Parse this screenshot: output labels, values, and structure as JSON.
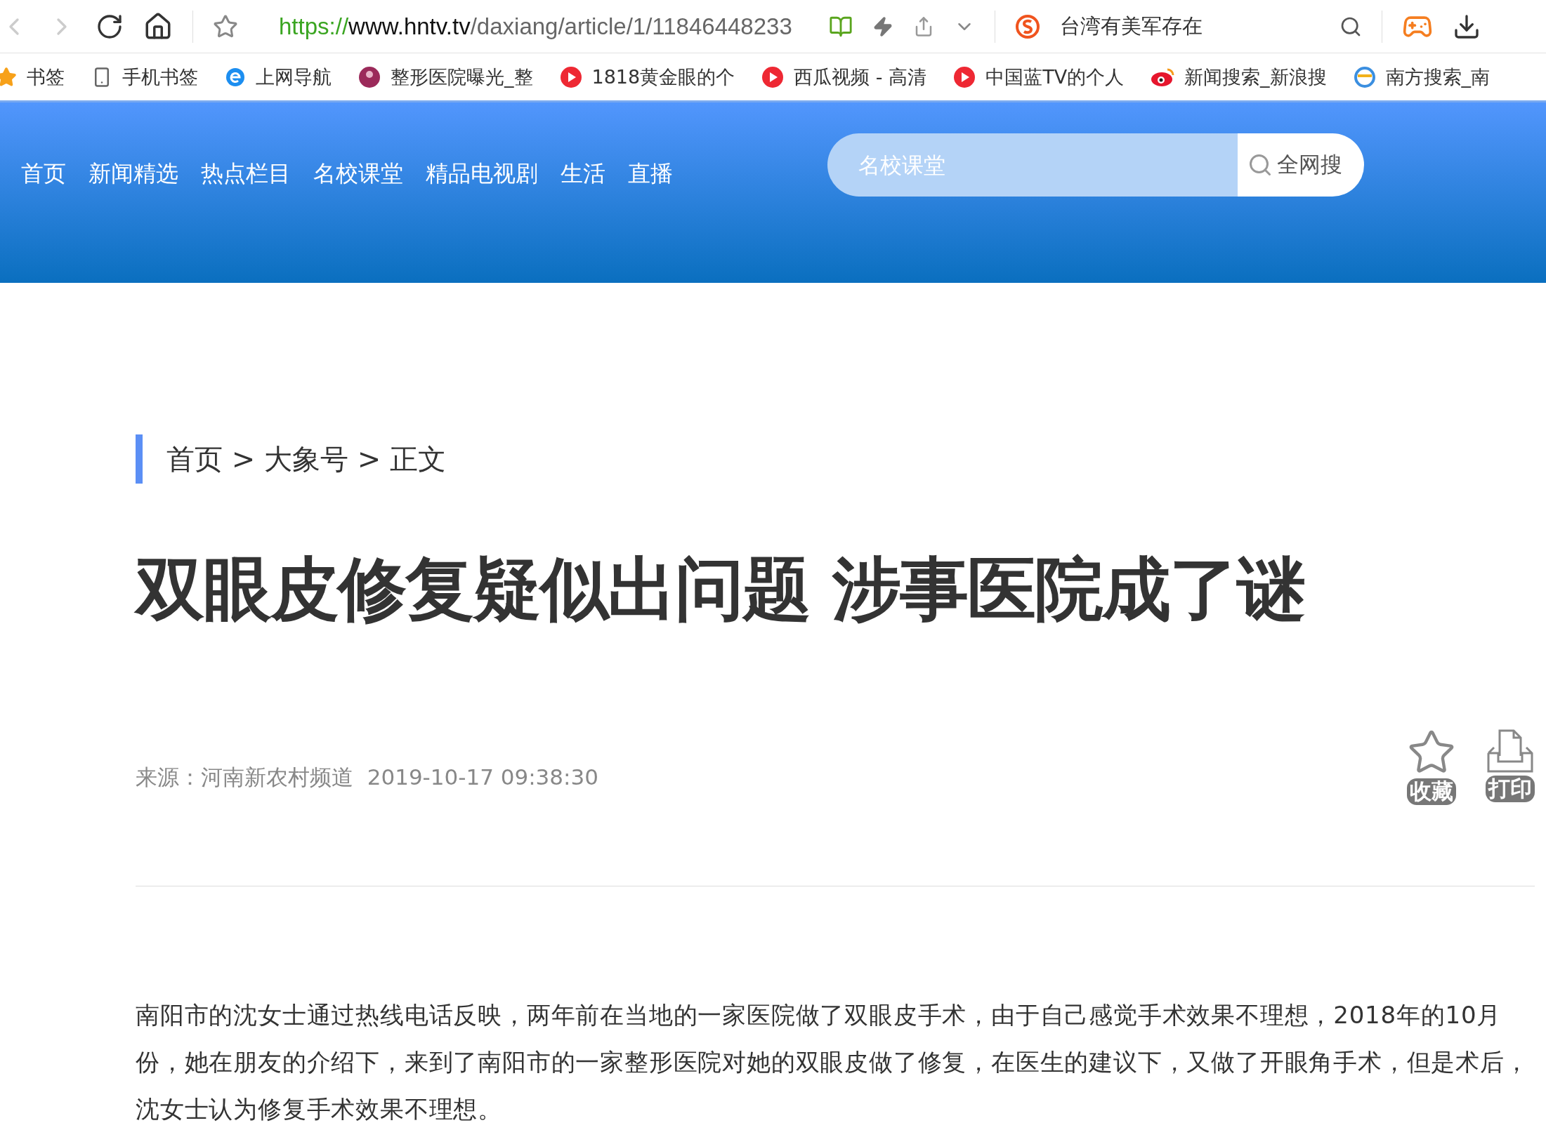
{
  "browser": {
    "url": {
      "scheme": "https://",
      "host": "www.hntv.tv",
      "path": "/daxiang/article/1/11846448233"
    },
    "search_text": "台湾有美军存在"
  },
  "bookmarks": [
    {
      "kind": "star",
      "label": "书签"
    },
    {
      "kind": "phone",
      "label": "手机书签"
    },
    {
      "kind": "ie",
      "label": "上网导航"
    },
    {
      "kind": "clinic",
      "label": "整形医院曝光_整"
    },
    {
      "kind": "video",
      "label": "1818黄金眼的个"
    },
    {
      "kind": "video",
      "label": "西瓜视频 - 高清"
    },
    {
      "kind": "video",
      "label": "中国蓝TV的个人"
    },
    {
      "kind": "weibo",
      "label": "新闻搜索_新浪搜"
    },
    {
      "kind": "globe",
      "label": "南方搜索_南"
    }
  ],
  "nav": [
    "首页",
    "新闻精选",
    "热点栏目",
    "名校课堂",
    "精品电视剧",
    "生活",
    "直播"
  ],
  "site_search": {
    "placeholder": "名校课堂",
    "button": "全网搜"
  },
  "breadcrumb": "首页 > 大象号 > 正文",
  "title": "双眼皮修复疑似出问题 涉事医院成了谜",
  "source": "来源：河南新农村频道",
  "date": "2019-10-17 09:38:30",
  "actions": [
    {
      "kind": "favorite",
      "label": "收藏"
    },
    {
      "kind": "print",
      "label": "打印"
    }
  ],
  "paragraph": "南阳市的沈女士通过热线电话反映，两年前在当地的一家医院做了双眼皮手术，由于自己感觉手术效果不理想，2018年的10月份，她在朋友的介绍下，来到了南阳市的一家整形医院对她的双眼皮做了修复，在医生的建议下，又做了开眼角手术，但是术后，沈女士认为修复手术效果不理想。"
}
